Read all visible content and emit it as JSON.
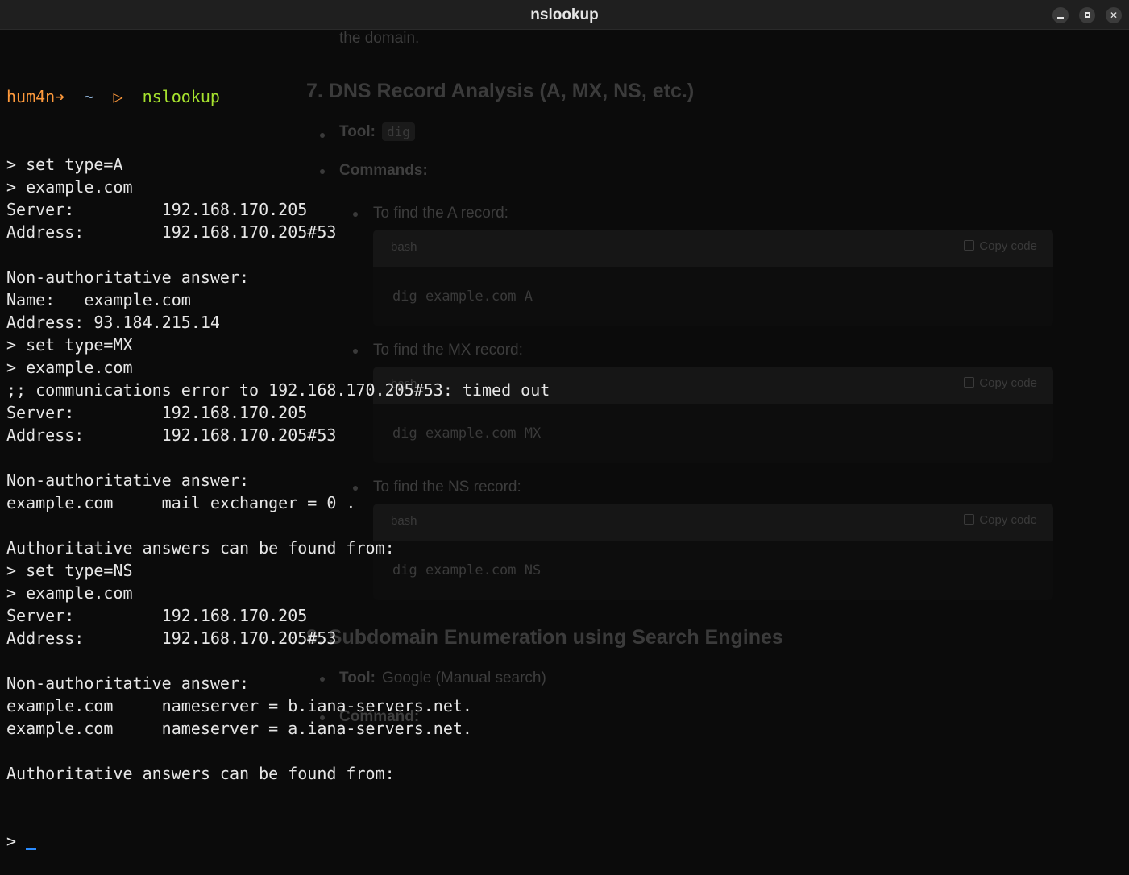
{
  "window": {
    "title": "nslookup",
    "minimize_glyph": "",
    "maximize_glyph": "",
    "close_glyph": "✕"
  },
  "background_page": {
    "top_fragment": "the domain.",
    "section7_heading": "7. DNS Record Analysis (A, MX, NS, etc.)",
    "tool_label": "Tool:",
    "tool_value": "dig",
    "commands_label": "Commands:",
    "items": [
      {
        "label": "To find the A record:",
        "lang": "bash",
        "copy": "Copy code",
        "code": "dig example.com A"
      },
      {
        "label": "To find the MX record:",
        "lang": "bash",
        "copy": "Copy code",
        "code": "dig example.com MX"
      },
      {
        "label": "To find the NS record:",
        "lang": "bash",
        "copy": "Copy code",
        "code": "dig example.com NS"
      }
    ],
    "section8_heading": "8. Subdomain Enumeration using Search Engines",
    "tool8_label": "Tool:",
    "tool8_value": "Google (Manual search)",
    "command_label": "Command:"
  },
  "terminal": {
    "prompt": {
      "user": "hum4n",
      "arrow": "➔",
      "dir": "~",
      "symbol": "▷",
      "command": "nslookup"
    },
    "lines": [
      "> set type=A",
      "> example.com",
      "Server:\t\t192.168.170.205",
      "Address:\t192.168.170.205#53",
      "",
      "Non-authoritative answer:",
      "Name:\texample.com",
      "Address: 93.184.215.14",
      "> set type=MX",
      "> example.com",
      ";; communications error to 192.168.170.205#53: timed out",
      "Server:\t\t192.168.170.205",
      "Address:\t192.168.170.205#53",
      "",
      "Non-authoritative answer:",
      "example.com\tmail exchanger = 0 .",
      "",
      "Authoritative answers can be found from:",
      "> set type=NS",
      "> example.com",
      "Server:\t\t192.168.170.205",
      "Address:\t192.168.170.205#53",
      "",
      "Non-authoritative answer:",
      "example.com\tnameserver = b.iana-servers.net.",
      "example.com\tnameserver = a.iana-servers.net.",
      "",
      "Authoritative answers can be found from:"
    ],
    "input_prompt": "> "
  }
}
